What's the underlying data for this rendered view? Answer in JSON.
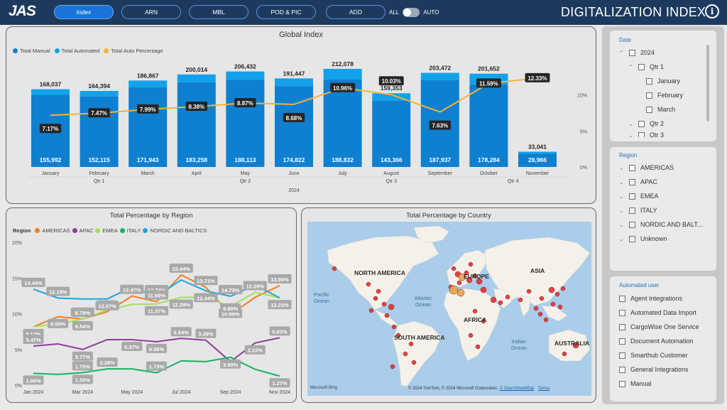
{
  "header": {
    "logo": "JAS",
    "nav": [
      "Index",
      "ARN",
      "MBL",
      "POD & PIC",
      "ADD"
    ],
    "toggle_left": "ALL",
    "toggle_right": "AUTO",
    "title": "DIGITALIZATION INDEX",
    "info": "i"
  },
  "global": {
    "title": "Global Index",
    "legend": [
      "Total Manual",
      "Total Automated",
      "Total Auto Percentage"
    ],
    "colors": {
      "manual": "#0f7fd0",
      "automated": "#13a2ea",
      "pct": "#f2b43b"
    },
    "year": "2024",
    "quarters": [
      "Qtr 1",
      "Qtr 2",
      "Qtr 3",
      "Qtr 4"
    ],
    "y2_ticks": [
      "10%",
      "5%",
      "0%"
    ]
  },
  "region": {
    "title": "Total Percentage by Region",
    "legend_title": "Region",
    "series_names": [
      "AMERICAS",
      "APAC",
      "EMEA",
      "ITALY",
      "NORDIC AND BALTICS"
    ],
    "colors": [
      "#f07d20",
      "#8f3b9e",
      "#a3e05a",
      "#18b25e",
      "#1ea4e0"
    ],
    "y_ticks": [
      "20%",
      "15%",
      "10%",
      "5%",
      "0%"
    ],
    "x_ticks": [
      "Jan 2024",
      "Mar 2024",
      "May 2024",
      "Jul 2024",
      "Sep 2024",
      "Nov 2024"
    ]
  },
  "country": {
    "title": "Total Percentage by Country",
    "continents": [
      "NORTH AMERICA",
      "EUROPE",
      "ASIA",
      "AFRICA",
      "SOUTH AMERICA",
      "AUSTRALIA"
    ],
    "oceans": [
      "Pacific Ocean",
      "Atlantic Ocean",
      "Indian Ocean"
    ],
    "bing": "Microsoft Bing",
    "copyright": "© 2024 TomTom, © 2024 Microsoft Corporation,",
    "osm": "© OpenStreetMap",
    "terms": "Terms"
  },
  "filters": {
    "date": {
      "title": "Date",
      "items": [
        "2024",
        "Qtr 1",
        "January",
        "February",
        "March",
        "Qtr 2",
        "Qtr 3"
      ]
    },
    "region": {
      "title": "Region",
      "items": [
        "AMERICAS",
        "APAC",
        "EMEA",
        "ITALY",
        "NORDIC AND BALT...",
        "Unknown"
      ]
    },
    "auto_user": {
      "title": "Automated user",
      "items": [
        "Agent Integrations",
        "Automated Data Import",
        "CargoWise One Service",
        "Document Automation",
        "Smarthub Customer",
        "General Integrations",
        "Manual"
      ]
    }
  },
  "chart_data": [
    {
      "type": "bar",
      "title": "Global Index",
      "categories": [
        "January",
        "February",
        "March",
        "April",
        "May",
        "June",
        "July",
        "August",
        "September",
        "October",
        "November"
      ],
      "series": [
        {
          "name": "Total Manual",
          "values": [
            155992,
            152115,
            171943,
            183258,
            188113,
            174822,
            188832,
            143366,
            187937,
            178284,
            28966
          ]
        },
        {
          "name": "Total Automated",
          "values": [
            12045,
            12279,
            14924,
            16756,
            18319,
            16625,
            23246,
            15987,
            15535,
            23368,
            4075
          ]
        },
        {
          "name": "Total Auto Percentage",
          "values": [
            7.17,
            7.47,
            7.99,
            8.38,
            8.87,
            8.68,
            10.96,
            10.03,
            7.63,
            11.59,
            12.33
          ]
        }
      ],
      "totals": [
        168037,
        164394,
        186867,
        200014,
        206432,
        191447,
        212078,
        159353,
        203472,
        201652,
        33041
      ],
      "manual_labels": [
        "155,992",
        "152,115",
        "171,943",
        "183,258",
        "188,113",
        "174,822",
        "188,832",
        "143,366",
        "187,937",
        "178,284",
        "28,966"
      ],
      "total_labels": [
        "168,037",
        "164,394",
        "186,867",
        "200,014",
        "206,432",
        "191,447",
        "212,078",
        "159,353",
        "203,472",
        "201,652",
        "33,041"
      ],
      "pct_labels": [
        "7.17%",
        "7.47%",
        "7.99%",
        "8.38%",
        "8.87%",
        "8.68%",
        "10.96%",
        "10.03%",
        "7.63%",
        "11.59%",
        "12.33%"
      ],
      "y2lim": [
        0,
        13.5
      ]
    },
    {
      "type": "line",
      "title": "Total Percentage by Region",
      "x": [
        "Jan",
        "Feb",
        "Mar",
        "Apr",
        "May",
        "Jun",
        "Jul",
        "Aug",
        "Sep",
        "Oct",
        "Nov"
      ],
      "ylim": [
        0,
        20
      ],
      "series": [
        {
          "name": "AMERICAS",
          "values": [
            8.17,
            9.58,
            9.27,
            10.28,
            12.47,
            11.69,
            15.44,
            13.71,
            9.86,
            12.29,
            13.94
          ]
        },
        {
          "name": "APAC",
          "values": [
            5.47,
            5.77,
            5.0,
            6.37,
            6.37,
            6.08,
            6.54,
            6.3,
            3.29,
            5.9,
            6.63
          ]
        },
        {
          "name": "EMEA",
          "values": [
            8.2,
            8.54,
            9.27,
            10.5,
            11.3,
            11.37,
            12.29,
            12.29,
            10.99,
            13.0,
            12.23
          ]
        },
        {
          "name": "ITALY",
          "values": [
            1.66,
            1.5,
            1.75,
            2.28,
            2.28,
            1.73,
            3.4,
            3.3,
            3.9,
            2.22,
            1.27
          ]
        },
        {
          "name": "NORDIC AND BALTICS",
          "values": [
            13.44,
            12.19,
            12.07,
            12.07,
            13.74,
            12.44,
            14.73,
            13.2,
            12.44,
            14.0,
            12.23
          ]
        }
      ],
      "labels": [
        {
          "series": "NORDIC AND BALTICS",
          "i": 0,
          "text": "13.44%"
        },
        {
          "series": "NORDIC AND BALTICS",
          "i": 1,
          "text": "12.19%"
        },
        {
          "series": "AMERICAS",
          "i": 0,
          "text": "8.17%"
        },
        {
          "series": "AMERICAS",
          "i": 1,
          "text": "9.58%"
        },
        {
          "series": "APAC",
          "i": 0,
          "text": "5.47%"
        },
        {
          "series": "ITALY",
          "i": 0,
          "text": "1.66%"
        },
        {
          "series": "EMEA",
          "i": 2,
          "text": "10.28%"
        },
        {
          "series": "EMEA",
          "i": 2,
          "text": "8.54%"
        },
        {
          "series": "AMERICAS",
          "i": 2,
          "text": "6.79%"
        },
        {
          "series": "APAC",
          "i": 2,
          "text": "5.77%"
        },
        {
          "series": "ITALY",
          "i": 2,
          "text": "1.75%"
        },
        {
          "series": "ITALY",
          "i": 2,
          "text": "1.50%"
        },
        {
          "series": "AMERICAS",
          "i": 3,
          "text": "9.27%"
        },
        {
          "series": "NORDIC AND BALTICS",
          "i": 3,
          "text": "12.07%"
        },
        {
          "series": "ITALY",
          "i": 3,
          "text": "2.28%"
        },
        {
          "series": "AMERICAS",
          "i": 4,
          "text": "12.47%"
        },
        {
          "series": "APAC",
          "i": 4,
          "text": "6.37%"
        },
        {
          "series": "NORDIC AND BALTICS",
          "i": 5,
          "text": "13.74%"
        },
        {
          "series": "EMEA",
          "i": 5,
          "text": "11.37%"
        },
        {
          "series": "AMERICAS",
          "i": 5,
          "text": "11.69%"
        },
        {
          "series": "APAC",
          "i": 5,
          "text": "6.08%"
        },
        {
          "series": "ITALY",
          "i": 5,
          "text": "1.73%"
        },
        {
          "series": "AMERICAS",
          "i": 6,
          "text": "15.44%"
        },
        {
          "series": "EMEA",
          "i": 6,
          "text": "12.29%"
        },
        {
          "series": "APAC",
          "i": 6,
          "text": "6.54%"
        },
        {
          "series": "AMERICAS",
          "i": 7,
          "text": "13.71%"
        },
        {
          "series": "NORDIC AND BALTICS",
          "i": 7,
          "text": "12.44%"
        },
        {
          "series": "APAC",
          "i": 7,
          "text": "3.29%"
        },
        {
          "series": "NORDIC AND BALTICS",
          "i": 8,
          "text": "14.73%"
        },
        {
          "series": "EMEA",
          "i": 8,
          "text": "10.99%"
        },
        {
          "series": "AMERICAS",
          "i": 8,
          "text": "9.86%"
        },
        {
          "series": "ITALY",
          "i": 8,
          "text": "3.90%"
        },
        {
          "series": "EMEA",
          "i": 9,
          "text": "12.29%"
        },
        {
          "series": "APAC",
          "i": 9,
          "text": "2.22%"
        },
        {
          "series": "AMERICAS",
          "i": 10,
          "text": "13.94%"
        },
        {
          "series": "EMEA",
          "i": 10,
          "text": "12.23%"
        },
        {
          "series": "APAC",
          "i": 10,
          "text": "6.63%"
        },
        {
          "series": "ITALY",
          "i": 10,
          "text": "1.27%"
        }
      ]
    }
  ]
}
